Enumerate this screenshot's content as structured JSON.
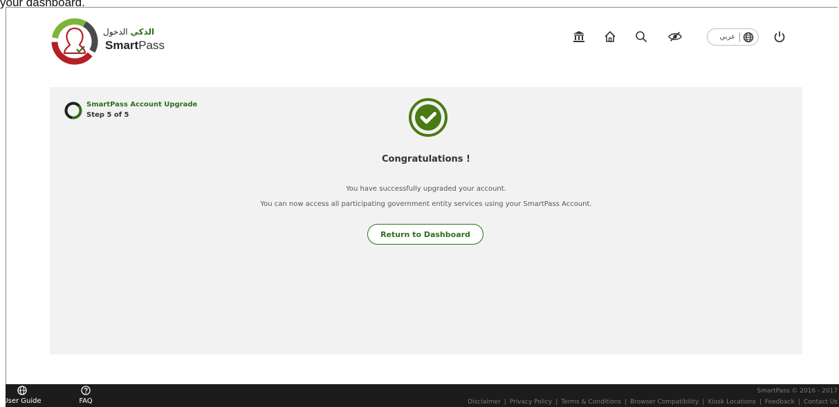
{
  "top_caption": "your dashboard.",
  "header": {
    "logo_arabic_prefix": "الدخول",
    "logo_arabic_bold": "الذكي",
    "logo_name_bold": "Smart",
    "logo_name_rest": "Pass",
    "language_toggle": "عربي",
    "icons": [
      "government-icon",
      "home-icon",
      "search-icon",
      "accessibility-icon",
      "globe-icon",
      "power-icon"
    ]
  },
  "step": {
    "title": "SmartPass Account Upgrade",
    "subtitle": "Step 5 of 5"
  },
  "main": {
    "heading": "Congratulations !",
    "message_1": "You have successfully upgraded your account.",
    "message_2": "You can now access all participating government entity services using your SmartPass Account.",
    "return_button": "Return to Dashboard"
  },
  "footer": {
    "user_guide": "User Guide",
    "faq": "FAQ",
    "copyright": "SmartPass © 2016 - 2017",
    "links": [
      "Disclaimer",
      "Privacy Policy",
      "Terms & Conditions",
      "Browser Compatibility",
      "Kiosk Locations",
      "Feedback",
      "Contact Us"
    ]
  },
  "colors": {
    "brand_green": "#2e6f1a",
    "footer_bg": "#1c1c1c",
    "panel_bg": "#f2f2f2",
    "logo_red": "#b32025"
  }
}
